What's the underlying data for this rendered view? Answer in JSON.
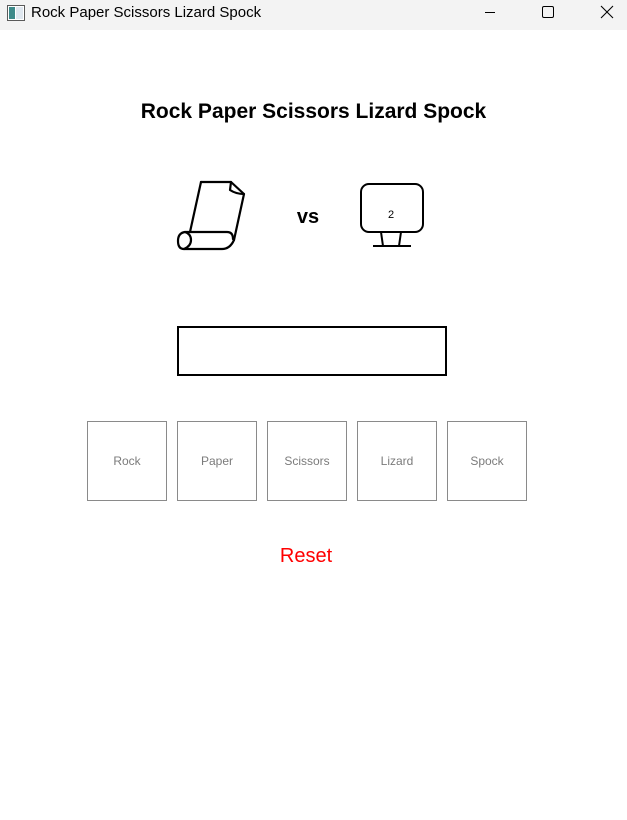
{
  "window": {
    "title": "Rock Paper Scissors Lizard Spock",
    "icon": "app-window-icon",
    "controls": [
      "minimize-icon",
      "maximize-icon",
      "close-icon"
    ]
  },
  "game": {
    "title": "Rock Paper Scissors Lizard Spock",
    "player_icon": "scroll-paper-icon",
    "vs_label": "vs",
    "computer_icon": "monitor-icon",
    "computer_value": "2",
    "result_text": ""
  },
  "choices": [
    {
      "label": "Rock"
    },
    {
      "label": "Paper"
    },
    {
      "label": "Scissors"
    },
    {
      "label": "Lizard"
    },
    {
      "label": "Spock"
    }
  ],
  "reset_label": "Reset",
  "colors": {
    "reset": "#ff0000",
    "button_text": "#7b7b7b",
    "titlebar": "#f3f3f3"
  }
}
